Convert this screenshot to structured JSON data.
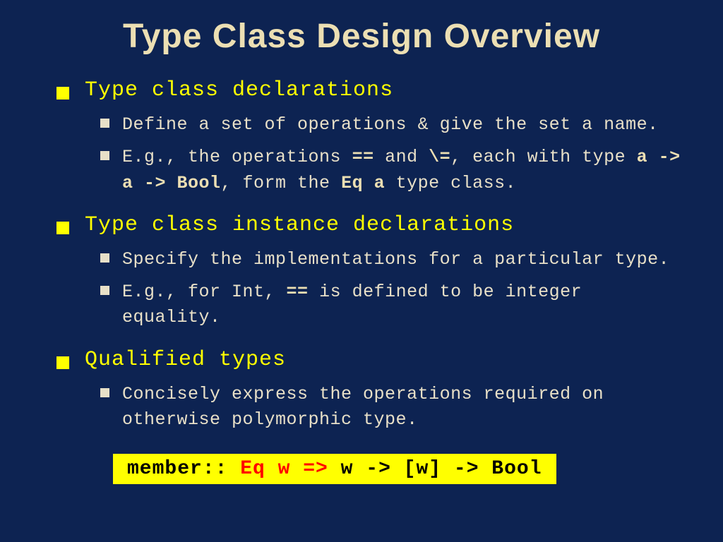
{
  "title": "Type Class Design Overview",
  "sections": [
    {
      "heading": "Type class declarations",
      "items": [
        {
          "plain": "Define a set of operations & give the set a name."
        },
        {
          "prefix": "E.g., the operations ",
          "op1": "==",
          "mid1": " and ",
          "op2": "\\=",
          "mid2": ", each with type ",
          "sig": "a -> a -> Bool",
          "mid3": ", form the ",
          "cls": "Eq a",
          "suffix": " type class."
        }
      ]
    },
    {
      "heading": "Type class instance declarations",
      "items": [
        {
          "plain": "Specify the implementations for a particular type."
        },
        {
          "prefix": "E.g., for Int, ",
          "op1": "==",
          "suffix": " is defined to be integer equality."
        }
      ]
    },
    {
      "heading": "Qualified types",
      "items": [
        {
          "plain": "Concisely express the operations required on otherwise polymorphic type."
        }
      ]
    }
  ],
  "codebox": {
    "p1": "member:: ",
    "p2": "Eq w =>",
    "p3": " w -> [w] -> Bool"
  }
}
